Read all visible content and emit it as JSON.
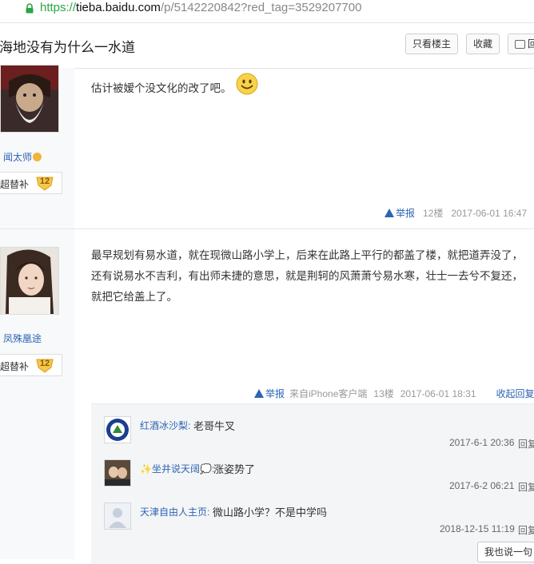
{
  "browser": {
    "url_scheme": "https://",
    "url_host": "tieba.baidu.com",
    "url_rest": "/p/5142220842?red_tag=3529207700"
  },
  "thread": {
    "title": "海地没有为什么一水道",
    "only_op_label": "只看楼主",
    "favorite_label": "收藏",
    "reply_label": "回复"
  },
  "floors": [
    {
      "user": "闻太师",
      "level_name": "超替补",
      "level": "12",
      "content": [
        "估计被嫒个没文化的改了吧。"
      ],
      "report_label": "举报",
      "floor_no": "12楼",
      "time": "2017-06-01 16:47"
    },
    {
      "user": "凤殊凰途",
      "level_name": "超替补",
      "level": "12",
      "content": [
        "最早规划有易水道，就在现微山路小学上，后来在此路上平行的都盖了楼，就把道弄没了，",
        "还有说易水不吉利，有出师未捷的意思，就是荆轲的风萧萧兮易水寒，壮士一去兮不复还，",
        "就把它给盖上了。"
      ],
      "report_label": "举报",
      "client": "来自iPhone客户端",
      "floor_no": "13楼",
      "time": "2017-06-01 18:31",
      "collapse_label": "收起回复",
      "comments": [
        {
          "user": "红酒冰沙梨:",
          "text": "老哥牛叉",
          "time": "2017-6-1 20:36",
          "reply": "回复"
        },
        {
          "user": "✨坐井说天阔💭:",
          "text": "涨姿势了",
          "time": "2017-6-2 06:21",
          "reply": "回复"
        },
        {
          "user": "天津自由人主页:",
          "text": "微山路小学？不是中学吗",
          "time": "2018-12-15 11:19",
          "reply": "回复"
        }
      ],
      "say_label": "我也说一句"
    }
  ],
  "colors": {
    "link": "#2d64b3",
    "sidebar_bg": "#f7f9fb",
    "secure_green": "#28a745"
  },
  "icons": [
    "lock-icon",
    "smiley-icon",
    "warning-icon",
    "level-badge-icon",
    "reply-icon"
  ]
}
